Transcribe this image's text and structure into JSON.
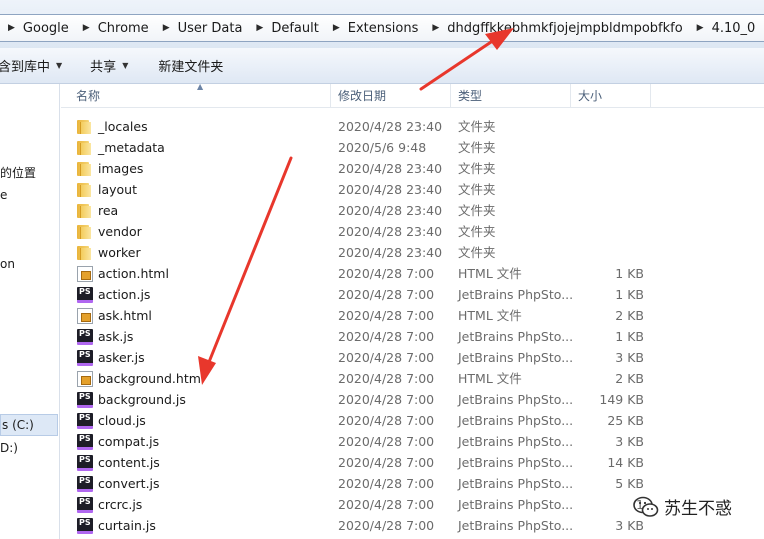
{
  "breadcrumb": [
    "Google",
    "Chrome",
    "User Data",
    "Default",
    "Extensions",
    "dhdgffkkebhmkfjojejmpbldmpobfkfo",
    "4.10_0"
  ],
  "toolbar": {
    "include_library": "含到库中",
    "share": "共享",
    "new_folder": "新建文件夹"
  },
  "nav": {
    "items": [
      {
        "label": "的位置"
      },
      {
        "label": "e"
      },
      {
        "label": "on"
      },
      {
        "label": "s (C:)"
      },
      {
        "label": "D:)"
      }
    ]
  },
  "columns": {
    "name": "名称",
    "date": "修改日期",
    "type": "类型",
    "size": "大小"
  },
  "files": [
    {
      "name": "_locales",
      "date": "2020/4/28 23:40",
      "type": "文件夹",
      "size": "",
      "icon": "folder"
    },
    {
      "name": "_metadata",
      "date": "2020/5/6 9:48",
      "type": "文件夹",
      "size": "",
      "icon": "folder"
    },
    {
      "name": "images",
      "date": "2020/4/28 23:40",
      "type": "文件夹",
      "size": "",
      "icon": "folder"
    },
    {
      "name": "layout",
      "date": "2020/4/28 23:40",
      "type": "文件夹",
      "size": "",
      "icon": "folder"
    },
    {
      "name": "rea",
      "date": "2020/4/28 23:40",
      "type": "文件夹",
      "size": "",
      "icon": "folder"
    },
    {
      "name": "vendor",
      "date": "2020/4/28 23:40",
      "type": "文件夹",
      "size": "",
      "icon": "folder"
    },
    {
      "name": "worker",
      "date": "2020/4/28 23:40",
      "type": "文件夹",
      "size": "",
      "icon": "folder"
    },
    {
      "name": "action.html",
      "date": "2020/4/28 7:00",
      "type": "HTML 文件",
      "size": "1 KB",
      "icon": "html"
    },
    {
      "name": "action.js",
      "date": "2020/4/28 7:00",
      "type": "JetBrains PhpSto...",
      "size": "1 KB",
      "icon": "ps"
    },
    {
      "name": "ask.html",
      "date": "2020/4/28 7:00",
      "type": "HTML 文件",
      "size": "2 KB",
      "icon": "html"
    },
    {
      "name": "ask.js",
      "date": "2020/4/28 7:00",
      "type": "JetBrains PhpSto...",
      "size": "1 KB",
      "icon": "ps"
    },
    {
      "name": "asker.js",
      "date": "2020/4/28 7:00",
      "type": "JetBrains PhpSto...",
      "size": "3 KB",
      "icon": "ps"
    },
    {
      "name": "background.html",
      "date": "2020/4/28 7:00",
      "type": "HTML 文件",
      "size": "2 KB",
      "icon": "html"
    },
    {
      "name": "background.js",
      "date": "2020/4/28 7:00",
      "type": "JetBrains PhpSto...",
      "size": "149 KB",
      "icon": "ps"
    },
    {
      "name": "cloud.js",
      "date": "2020/4/28 7:00",
      "type": "JetBrains PhpSto...",
      "size": "25 KB",
      "icon": "ps"
    },
    {
      "name": "compat.js",
      "date": "2020/4/28 7:00",
      "type": "JetBrains PhpSto...",
      "size": "3 KB",
      "icon": "ps"
    },
    {
      "name": "content.js",
      "date": "2020/4/28 7:00",
      "type": "JetBrains PhpSto...",
      "size": "14 KB",
      "icon": "ps"
    },
    {
      "name": "convert.js",
      "date": "2020/4/28 7:00",
      "type": "JetBrains PhpSto...",
      "size": "5 KB",
      "icon": "ps"
    },
    {
      "name": "crcrc.js",
      "date": "2020/4/28 7:00",
      "type": "JetBrains PhpSto...",
      "size": "1",
      "icon": "ps"
    },
    {
      "name": "curtain.js",
      "date": "2020/4/28 7:00",
      "type": "JetBrains PhpSto...",
      "size": "3 KB",
      "icon": "ps"
    }
  ],
  "watermark": {
    "text": "苏生不惑"
  },
  "colors": {
    "annotation_arrow": "#e8372c",
    "selection": "#dde8f6"
  }
}
